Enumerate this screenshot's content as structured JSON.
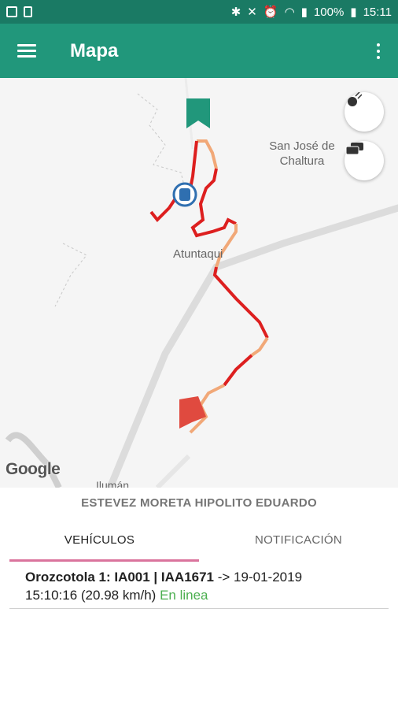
{
  "status_bar": {
    "battery": "100%",
    "time": "15:11"
  },
  "app_bar": {
    "title": "Mapa",
    "menu_icon": "menu-icon",
    "more_icon": "more-vert-icon"
  },
  "map": {
    "places": [
      {
        "name": "San José de\nChaltura"
      },
      {
        "name": "Atuntaqui"
      },
      {
        "name": "Ilumán"
      }
    ],
    "attribution": "Google",
    "route_colors": {
      "primary": "#dd1f1f",
      "secondary": "#f1a878"
    },
    "start_marker_color": "#21977b",
    "end_marker_color": "#e04a3f",
    "buttons": [
      {
        "icon": "satellite-icon"
      },
      {
        "icon": "traffic-icon"
      }
    ]
  },
  "owner_name": "ESTEVEZ MORETA HIPOLITO EDUARDO",
  "tabs": [
    {
      "label": "VEHÍCULOS",
      "active": true
    },
    {
      "label": "NOTIFICACIÓN",
      "active": false
    }
  ],
  "vehicle": {
    "name": "Orozcotola 1: IA001 | IAA1671",
    "timestamp": "-> 19-01-2019",
    "time_speed": "15:10:16 (20.98 km/h)",
    "status": "En linea"
  }
}
